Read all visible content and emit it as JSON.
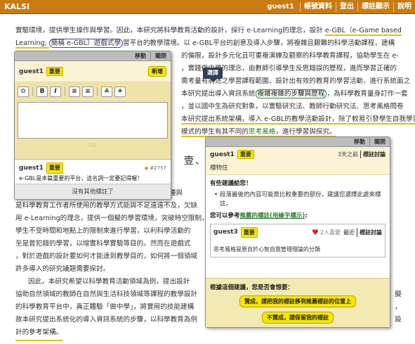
{
  "topbar": {
    "brand": "KALSI",
    "user": "guest1",
    "items": [
      "帳號資料",
      "登出",
      "標註顯示",
      "說明"
    ]
  },
  "article": {
    "lines": [
      {
        "prefix": "，",
        "segments": [
          {
            "t": "實驗環境，提供學生操作與學習。因此，本研究將科學教育活動的設計，採行 e-Learning的理念，設計 "
          },
          {
            "t": "e-GBL（e-Game based",
            "style": "ul"
          }
        ]
      },
      {
        "segments": [
          {
            "t": "Learning, ",
            "style": "ul"
          },
          {
            "t": "簡稱 e-GBL）遊戲式學",
            "style": "blue"
          },
          {
            "t": "習平台的教學環境。以 e-GBL平台的創意及導入步驟，將複雜且艱難的科學活動課程，建構"
          }
        ]
      },
      {
        "segments": [
          {
            "t": "的偏限，設計多元化且可重複演練及觀察的科學教育課程，協助學生在 e-"
          }
        ]
      },
      {
        "segments": [
          {
            "t": "，實踐做中學的理念，由數師引導學生反思錯誤的歷程，進而學習正確的"
          }
        ]
      },
      {
        "segments": [
          {
            "t": "需考量有前述之學習課程範圍、設計出有效的教育的學習活動、進行系統面之"
          }
        ]
      },
      {
        "segments": [
          {
            "t": "本研究提出導入資訊系統"
          },
          {
            "t": "複雜複雜的步驟與歷程",
            "style": "green"
          },
          {
            "t": "，為科學教育量身訂作一套"
          }
        ]
      },
      {
        "segments": [
          {
            "t": "，並以國中生為研究對象，以實驗研究法、教師行動研究法、思考風格問卷"
          }
        ]
      },
      {
        "segments": [
          {
            "t": "本研究提出系統架構，導入 e-GBL的教學活動設計，除了較易引發學生自我學習的意",
            "style": "ul"
          }
        ]
      },
      {
        "segments": [
          {
            "t": "模式的學生有其不同的",
            "style": "ul"
          },
          {
            "t": "思考風格",
            "style": "linkgreen"
          },
          {
            "t": "，進行學習與探究。",
            "style": "ul"
          }
        ]
      }
    ],
    "section_title": "壹、",
    "lower_lines": [
      "植物栽種與",
      "是科學教育工作者所使用的教學方式能與不足遠遠不及，欠缺",
      "用 e-Learning的理念，提供一個擬的學習環境，突破時空限制，",
      "學生不受時間和地點上的限制來進行學習，以利科學活動的",
      "至是曾犯錯的學習，以增實科學實驗等目的。然而在遊戲式",
      "，對於遊戲的設計要如何才能達到教學目的，如何將一個領域",
      "許多導入的研究議題需要探討。",
      "因此，本研究希望以科學教育活動領域為例，提出設計",
      "協助自然領域的教師在自然與生活科技領域等課程的教學設計",
      "的科學教育平台中，真正體驗「做中學」，將實用的技能建構",
      "故本研究提出系統化的導入資訊系統的步驟，以科學教育為例"
    ],
    "lower_tail_1": "擬",
    "lower_tail_2": "，",
    "lower_tail_3": "設",
    "lower_final": "計的參考架構。"
  },
  "left_panel": {
    "header": [
      "移動",
      "關閉"
    ],
    "user": "guest1",
    "badge": "重要",
    "add_button": "新增",
    "toolbar": [
      "B",
      "I",
      "≡",
      "≡",
      "♣",
      "♠"
    ],
    "resize": "::::",
    "item_user": "guest1",
    "item_badge": "重要",
    "item_num": "#2757",
    "item_text": "e-GBL是本篇重要的平台，這名詞一定要記得喔！",
    "footer": "沒有其他標註了"
  },
  "tooltip": "選擇",
  "right_panel": {
    "header": [
      "移動",
      "關閉"
    ],
    "user": "guest1",
    "badge": "重要",
    "time": "3天之前",
    "discuss": "標註討論",
    "tag": "標物住",
    "suggestion_title": "有些建議給您！",
    "suggestion_bullet": "段落最後的內容可能是比較重要的部份，建議您選擇此處來標註。",
    "ref_prefix": "您可以參考",
    "ref_link": "推薦的標註(用綠字標示)",
    "ref_suffix": ":",
    "card_user": "guest3",
    "card_badge": "重要",
    "card_likes": "2人喜愛",
    "card_latest": "最近",
    "card_discuss": "標註討論",
    "card_desc": "思考風格是原自於心智自我管理理論的分類",
    "bottom_question": "根據這個建議，您是否會想要：",
    "bottom_btn1": "贊成，請把我的標註移到推薦標註的位置上",
    "bottom_btn2": "不贊成，請保留我的標註"
  },
  "colors": {
    "topbar": "#c87b12",
    "badge": "#f6e600",
    "panel_head": "#bdbdbd",
    "editor_bg": "#f0e3a8",
    "link_green": "#2c7a2c",
    "blue_highlight": "#4040b0"
  }
}
